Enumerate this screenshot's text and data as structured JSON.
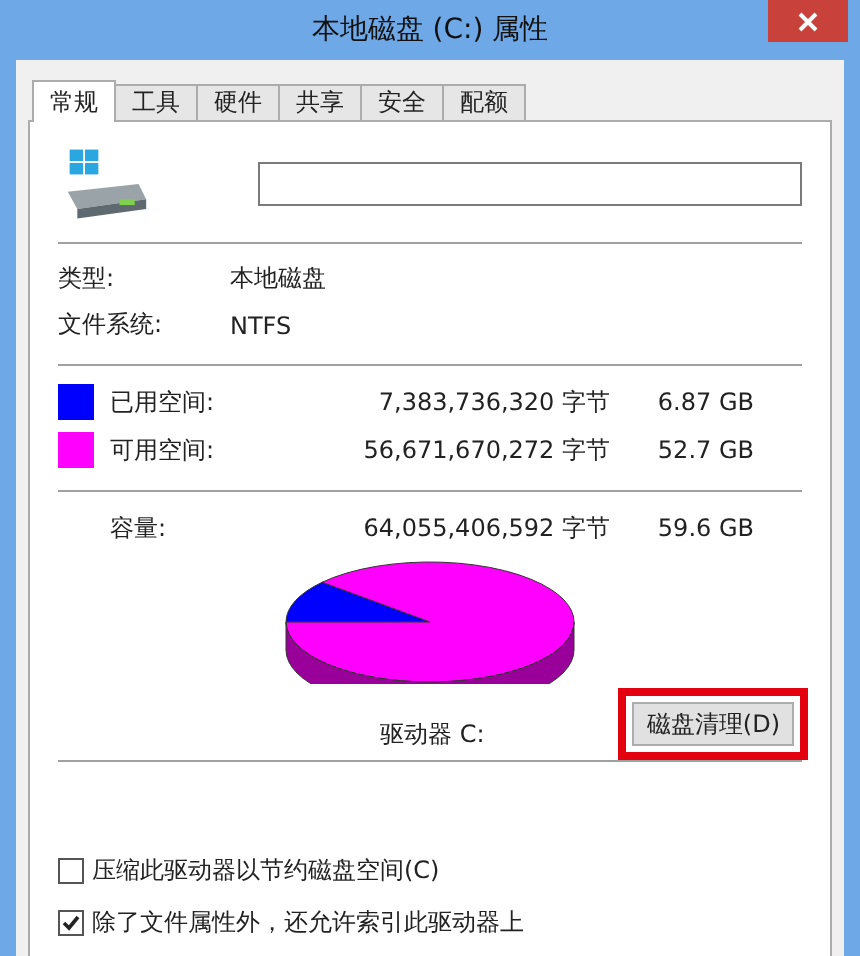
{
  "window": {
    "title": "本地磁盘 (C:) 属性"
  },
  "tabs": [
    {
      "label": "常规",
      "selected": true
    },
    {
      "label": "工具",
      "selected": false
    },
    {
      "label": "硬件",
      "selected": false
    },
    {
      "label": "共享",
      "selected": false
    },
    {
      "label": "安全",
      "selected": false
    },
    {
      "label": "配额",
      "selected": false
    }
  ],
  "info": [
    {
      "label": "类型:",
      "value": "本地磁盘"
    },
    {
      "label": "文件系统:",
      "value": "NTFS"
    }
  ],
  "space": [
    {
      "label": "已用空间:",
      "bytes": "7,383,736,320 字节",
      "size": "6.87 GB",
      "color": "#0000ff"
    },
    {
      "label": "可用空间:",
      "bytes": "56,671,670,272 字节",
      "size": "52.7 GB",
      "color": "#ff00ff"
    }
  ],
  "capacity": {
    "label": "容量:",
    "bytes": "64,055,406,592 字节",
    "size": "59.6 GB"
  },
  "drive_label": "驱动器 C:",
  "cleanup_button": {
    "label": "磁盘清理(D)",
    "highlighted": true
  },
  "options": [
    {
      "label": "压缩此驱动器以节约磁盘空间(C)",
      "checked": false
    },
    {
      "label": "除了文件属性外，还允许索引此驱动器上",
      "checked": true
    }
  ]
}
